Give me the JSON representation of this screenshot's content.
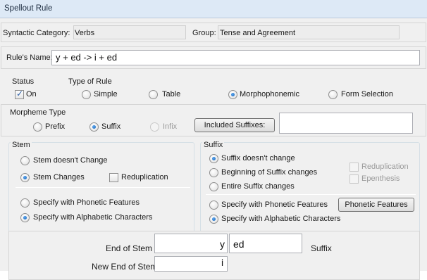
{
  "window": {
    "title": "Spellout Rule"
  },
  "category": {
    "label": "Syntactic Category:",
    "value": "Verbs"
  },
  "group": {
    "label": "Group:",
    "value": "Tense and Agreement"
  },
  "rule_name": {
    "label": "Rule's Name:",
    "value": "y + ed -> i + ed"
  },
  "status": {
    "title": "Status",
    "on_label": "On",
    "checked": true
  },
  "rule_type": {
    "title": "Type of Rule",
    "options": [
      "Simple",
      "Table",
      "Morphophonemic",
      "Form Selection"
    ],
    "selected": "Morphophonemic"
  },
  "morpheme_type": {
    "title": "Morpheme Type",
    "options": [
      "Prefix",
      "Suffix",
      "Infix"
    ],
    "selected": "Suffix",
    "included_button": "Included Suffixes:",
    "included_value": ""
  },
  "stem": {
    "title": "Stem",
    "unchanged": "Stem doesn't Change",
    "changes": "Stem Changes",
    "selected": "Stem Changes",
    "reduplication": "Reduplication",
    "phonetic": "Specify with Phonetic Features",
    "alphabetic": "Specify with Alphabetic Characters",
    "spec_selected": "Specify with Alphabetic Characters"
  },
  "suffix": {
    "title": "Suffix",
    "options": [
      "Suffix doesn't change",
      "Beginning of Suffix changes",
      "Entire Suffix changes"
    ],
    "selected": "Suffix doesn't change",
    "reduplication": "Reduplication",
    "epenthesis": "Epenthesis",
    "phonetic": "Specify with Phonetic Features",
    "alphabetic": "Specify with Alphabetic Characters",
    "spec_selected": "Specify with Alphabetic Characters",
    "phonetic_button": "Phonetic Features"
  },
  "bottom": {
    "end_of_stem_label": "End of Stem",
    "end_of_stem_value": "y",
    "suffix_value": "ed",
    "suffix_label": "Suffix",
    "new_end_label": "New End of Stem",
    "new_end_value": "i"
  }
}
